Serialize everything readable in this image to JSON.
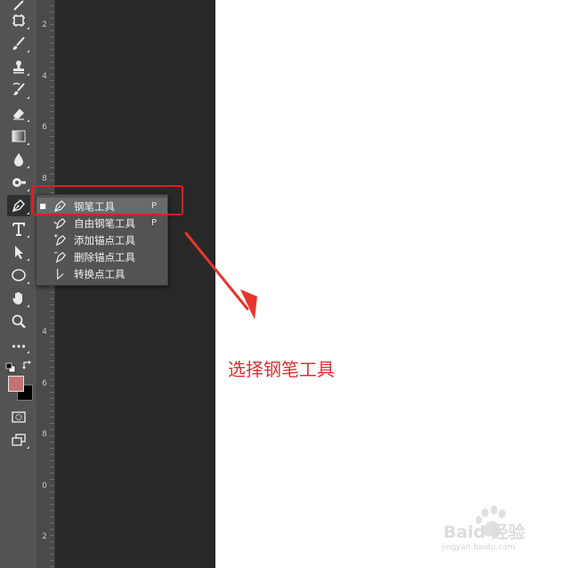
{
  "flyout": {
    "items": [
      {
        "label": "钢笔工具",
        "shortcut": "P",
        "selected": true,
        "icon": "pen-icon"
      },
      {
        "label": "自由钢笔工具",
        "shortcut": "P",
        "selected": false,
        "icon": "freeform-pen-icon"
      },
      {
        "label": "添加锚点工具",
        "shortcut": "",
        "selected": false,
        "icon": "add-anchor-point-icon"
      },
      {
        "label": "删除锚点工具",
        "shortcut": "",
        "selected": false,
        "icon": "delete-anchor-point-icon"
      },
      {
        "label": "转换点工具",
        "shortcut": "",
        "selected": false,
        "icon": "convert-point-icon"
      }
    ]
  },
  "ruler": {
    "labels": [
      "2",
      "4",
      "6",
      "8",
      "0",
      "2",
      "4",
      "6",
      "8",
      "0",
      "2"
    ]
  },
  "annotation": {
    "caption": "选择钢笔工具",
    "color": "#e41d1d"
  },
  "colors": {
    "foreground": "#c47474",
    "background": "#000000"
  },
  "watermark": {
    "brand": "Baid 经验",
    "url": "jingyan.baidu.com"
  },
  "toolbar": {
    "tools": [
      "brush-partial-icon",
      "artboard-icon",
      "brush-icon",
      "stamp-icon",
      "history-brush-icon",
      "eraser-icon",
      "gradient-icon",
      "blur-icon",
      "dodge-icon",
      "pen-icon",
      "type-icon",
      "path-selection-icon",
      "ellipse-icon",
      "hand-icon",
      "zoom-icon",
      "more-tools-icon",
      "default-colors-icon",
      "swap-colors-icon",
      "quick-mask-icon",
      "screen-mode-icon"
    ]
  }
}
